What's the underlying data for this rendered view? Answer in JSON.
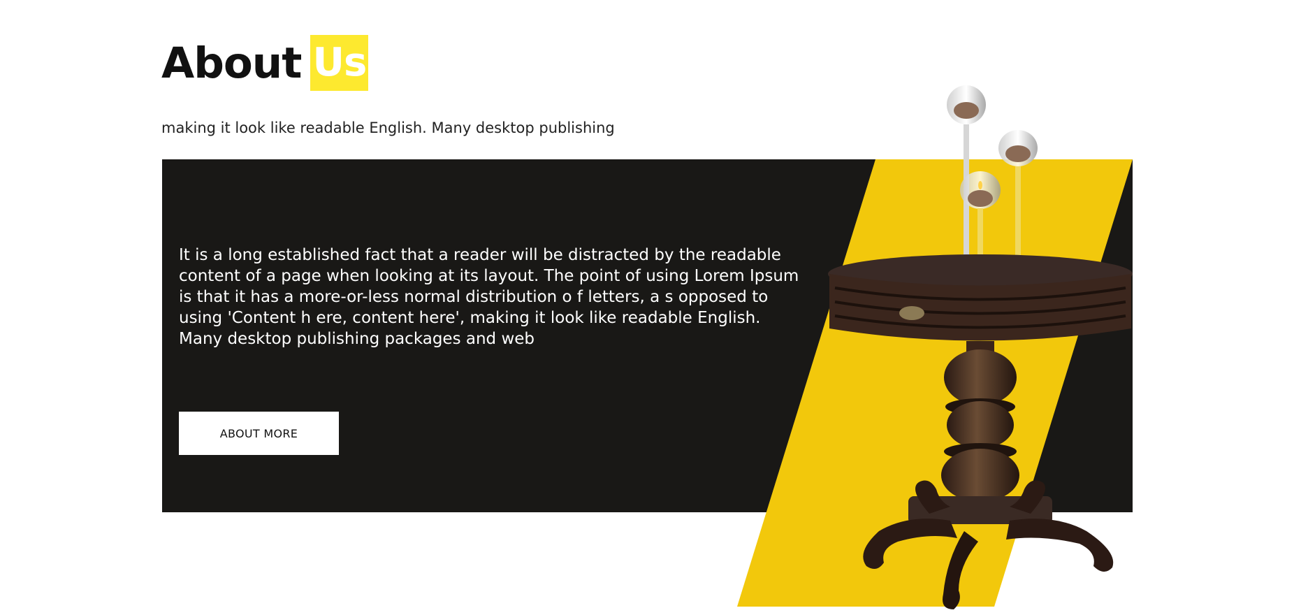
{
  "heading": {
    "word1": "About",
    "word2": "Us"
  },
  "subtitle": "making it look like readable English. Many desktop publishing",
  "body": "It is a long established fact that a reader will be distracted by the readable content of a page when looking at its layout. The point of using Lorem Ipsum is that it has a more-or-less normal distribution o f letters, a s opposed to using 'Content h ere, content here', making it look like readable English. Many desktop publishing packages and web",
  "button": {
    "label": "ABOUT MORE"
  },
  "colors": {
    "accent": "#fde92f",
    "stripe": "#f2c80c",
    "panel": "#191816",
    "text_dark": "#111111"
  },
  "image": {
    "icon": "side-table-with-candles"
  }
}
